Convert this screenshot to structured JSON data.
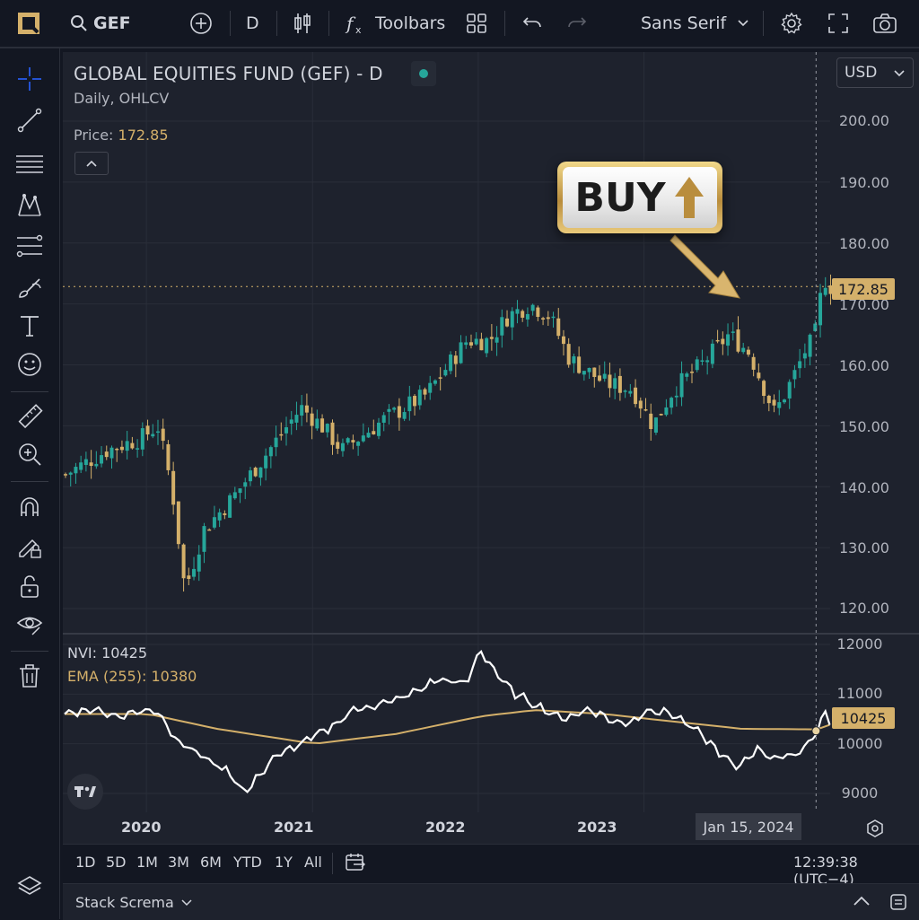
{
  "header": {
    "symbol": "GEF",
    "interval": "D",
    "toolbars_label": "Toolbars",
    "font_selector": "Sans Serif",
    "icons": [
      "logo-icon",
      "search-icon",
      "add-symbol-icon",
      "candles-icon",
      "formula-icon",
      "layout-grid-icon",
      "undo-icon",
      "redo-icon",
      "settings-icon",
      "fullscreen-icon",
      "camera-icon"
    ]
  },
  "left_toolbar": {
    "icons": [
      "crosshair-icon",
      "trend-line-icon",
      "horizontal-lines-icon",
      "pattern-icon",
      "fib-icon",
      "brush-icon",
      "text-icon",
      "emoji-icon",
      "ruler-icon",
      "zoom-icon",
      "magnet-icon",
      "lock-draw-icon",
      "unlock-icon",
      "eye-icon",
      "trash-icon"
    ],
    "bottom_icon": "layers-icon"
  },
  "legend": {
    "title": "GLOBAL EQUITIES FUND (GEF) - D",
    "subtitle": "Daily, OHLCV",
    "price_label": "Price:",
    "price_value": "172.85"
  },
  "currency": "USD",
  "price_axis": [
    "200.00",
    "190.00",
    "180.00",
    "170.00",
    "160.00",
    "150.00",
    "140.00",
    "130.00",
    "120.00"
  ],
  "indicator_axis": [
    "12000",
    "11000",
    "10000",
    "9000"
  ],
  "last_price_tag": "172.85",
  "nvi_tag": "10425",
  "indicator": {
    "nvi_label": "NVI: 10425",
    "ema_label": "EMA (255): 10380"
  },
  "time_axis": [
    "2020",
    "2021",
    "2022",
    "2023"
  ],
  "crosshair_date": "Jan 15, 2024",
  "annotation": {
    "text": "BUY"
  },
  "timeframes": [
    "1D",
    "5D",
    "1M",
    "3M",
    "6M",
    "YTD",
    "1Y",
    "All"
  ],
  "clock": "12:39:38 (UTC−4)",
  "footer": {
    "panel_label": "Stack Screma"
  },
  "colors": {
    "up": "#26a69a",
    "down": "#d4b06a",
    "accent": "#d4b06a",
    "background": "#1e222d"
  },
  "chart_data": {
    "type": "candlestick",
    "price_range": [
      115,
      205
    ],
    "indicator_range": [
      8800,
      12200
    ],
    "x_range": [
      "2019-07-01",
      "2024-02-15"
    ],
    "price_path": [
      [
        "2019-07-01",
        142
      ],
      [
        "2019-10-01",
        146
      ],
      [
        "2019-12-15",
        148
      ],
      [
        "2020-01-20",
        150
      ],
      [
        "2020-02-20",
        140
      ],
      [
        "2020-03-20",
        123
      ],
      [
        "2020-05-01",
        133
      ],
      [
        "2020-07-01",
        138
      ],
      [
        "2020-09-01",
        144
      ],
      [
        "2020-12-01",
        153
      ],
      [
        "2021-01-15",
        150
      ],
      [
        "2021-03-01",
        146
      ],
      [
        "2021-06-01",
        151
      ],
      [
        "2021-09-01",
        155
      ],
      [
        "2021-12-01",
        164
      ],
      [
        "2022-01-20",
        164
      ],
      [
        "2022-03-01",
        168
      ],
      [
        "2022-04-20",
        170
      ],
      [
        "2022-06-01",
        168
      ],
      [
        "2022-07-15",
        161
      ],
      [
        "2022-10-01",
        157
      ],
      [
        "2022-12-01",
        156
      ],
      [
        "2023-01-15",
        150
      ],
      [
        "2023-03-01",
        156
      ],
      [
        "2023-05-01",
        160
      ],
      [
        "2023-07-01",
        165
      ],
      [
        "2023-08-15",
        162
      ],
      [
        "2023-10-10",
        152
      ],
      [
        "2023-11-20",
        158
      ],
      [
        "2023-12-20",
        163
      ],
      [
        "2024-01-05",
        164
      ],
      [
        "2024-01-15",
        170
      ],
      [
        "2024-01-30",
        174
      ],
      [
        "2024-02-10",
        172.85
      ]
    ],
    "nvi_path": [
      [
        "2019-07-01",
        10600
      ],
      [
        "2019-09-01",
        10700
      ],
      [
        "2019-11-01",
        10550
      ],
      [
        "2019-12-15",
        10650
      ],
      [
        "2020-01-20",
        10700
      ],
      [
        "2020-03-01",
        10100
      ],
      [
        "2020-04-20",
        9800
      ],
      [
        "2020-07-01",
        9400
      ],
      [
        "2020-08-01",
        9000
      ],
      [
        "2020-10-01",
        9700
      ],
      [
        "2020-12-01",
        10000
      ],
      [
        "2021-02-01",
        10300
      ],
      [
        "2021-04-01",
        10700
      ],
      [
        "2021-06-01",
        10800
      ],
      [
        "2021-08-01",
        11000
      ],
      [
        "2021-10-01",
        11300
      ],
      [
        "2021-12-01",
        11200
      ],
      [
        "2022-01-01",
        11900
      ],
      [
        "2022-02-15",
        11300
      ],
      [
        "2022-03-20",
        11000
      ],
      [
        "2022-05-01",
        10800
      ],
      [
        "2022-07-01",
        10500
      ],
      [
        "2022-09-01",
        10700
      ],
      [
        "2022-11-01",
        10400
      ],
      [
        "2022-12-15",
        10500
      ],
      [
        "2023-01-01",
        10700
      ],
      [
        "2023-03-01",
        10600
      ],
      [
        "2023-05-01",
        10200
      ],
      [
        "2023-06-15",
        9800
      ],
      [
        "2023-07-20",
        9500
      ],
      [
        "2023-09-01",
        9900
      ],
      [
        "2023-10-15",
        9700
      ],
      [
        "2023-12-01",
        9800
      ],
      [
        "2024-01-15",
        10250
      ],
      [
        "2024-01-30",
        10700
      ],
      [
        "2024-02-10",
        10425
      ]
    ],
    "ema_path": [
      [
        "2019-07-01",
        10600
      ],
      [
        "2020-01-01",
        10600
      ],
      [
        "2020-06-01",
        10300
      ],
      [
        "2021-01-01",
        10000
      ],
      [
        "2021-07-01",
        10200
      ],
      [
        "2022-01-01",
        10550
      ],
      [
        "2022-05-01",
        10680
      ],
      [
        "2022-10-01",
        10600
      ],
      [
        "2023-03-01",
        10450
      ],
      [
        "2023-08-01",
        10300
      ],
      [
        "2024-01-15",
        10290
      ],
      [
        "2024-02-10",
        10380
      ]
    ],
    "series": [
      {
        "name": "NVI",
        "values": [
          "10425"
        ]
      },
      {
        "name": "EMA (255)",
        "values": [
          "10380"
        ]
      }
    ]
  }
}
